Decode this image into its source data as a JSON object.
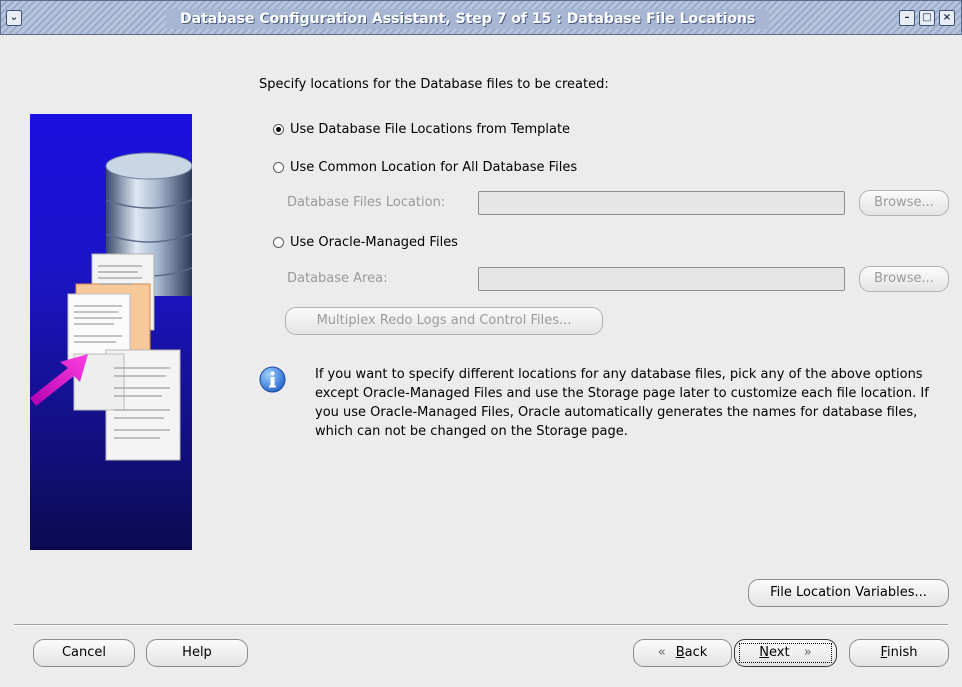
{
  "window": {
    "title": "Database Configuration Assistant, Step 7 of 15 : Database File Locations",
    "menu_glyph": "⌄",
    "min_glyph": "–",
    "max_glyph": "□",
    "close_glyph": "×"
  },
  "main": {
    "heading": "Specify locations for the Database files to be created:",
    "options": [
      {
        "label": "Use Database File Locations from Template",
        "selected": true
      },
      {
        "label": "Use Common Location for All Database Files",
        "selected": false
      },
      {
        "label": "Use Oracle-Managed Files",
        "selected": false
      }
    ],
    "files_location": {
      "label": "Database Files Location:",
      "value": "",
      "browse": "Browse..."
    },
    "database_area": {
      "label": "Database Area:",
      "value": "",
      "browse": "Browse..."
    },
    "multiplex_button": "Multiplex Redo Logs and Control Files...",
    "info_text": "If you want to specify different locations for any database files, pick any of the above options except Oracle-Managed Files and use the Storage page later to customize each file location. If you use Oracle-Managed Files, Oracle automatically generates the names for database files, which can not be changed on the Storage page.",
    "file_location_variables": "File Location Variables..."
  },
  "footer": {
    "cancel": "Cancel",
    "help": "Help",
    "back_arrow": "«",
    "back_mnemonic": "B",
    "back_rest": "ack",
    "next_mnemonic": "N",
    "next_rest": "ext",
    "next_arrow": "»",
    "finish_mnemonic": "F",
    "finish_rest": "inish"
  },
  "colors": {
    "titlebar": "#a7b6d3",
    "background": "#ececec",
    "side_panel": "#1a10e0",
    "info_icon": "#2b6fd6",
    "arrow": "#e020c8"
  },
  "icons": [
    "window-menu-icon",
    "minimize-icon",
    "maximize-icon",
    "close-icon",
    "database-cylinder-icon",
    "documents-icon",
    "arrow-icon",
    "info-icon"
  ]
}
